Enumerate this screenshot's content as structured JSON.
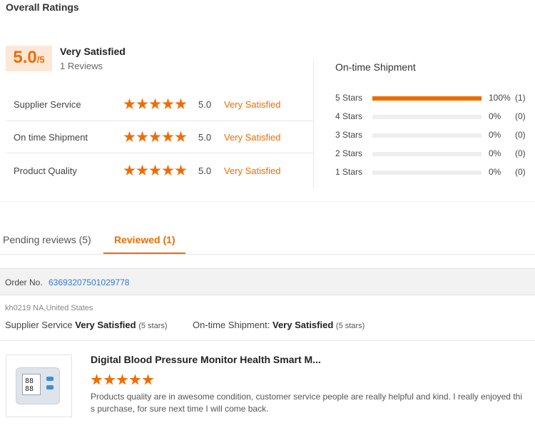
{
  "section_title": "Overall Ratings",
  "overall": {
    "score": "5.0",
    "out_of": "/5",
    "label": "Very Satisfied",
    "reviews": "1 Reviews"
  },
  "ratings": [
    {
      "label": "Supplier Service",
      "score": "5.0",
      "text": "Very Satisfied",
      "stars": 5
    },
    {
      "label": "On time Shipment",
      "score": "5.0",
      "text": "Very Satisfied",
      "stars": 5
    },
    {
      "label": "Product Quality",
      "score": "5.0",
      "text": "Very Satisfied",
      "stars": 5
    }
  ],
  "shipment": {
    "title": "On-time Shipment",
    "rows": [
      {
        "label": "5  Stars",
        "percent": "100%",
        "count": "(1)",
        "fill": 1.0
      },
      {
        "label": "4  Stars",
        "percent": "0%",
        "count": "(0)",
        "fill": 0
      },
      {
        "label": "3  Stars",
        "percent": "0%",
        "count": "(0)",
        "fill": 0
      },
      {
        "label": "2  Stars",
        "percent": "0%",
        "count": "(0)",
        "fill": 0
      },
      {
        "label": "1  Stars",
        "percent": "0%",
        "count": "(0)",
        "fill": 0
      }
    ]
  },
  "tabs": {
    "pending": "Pending reviews (5)",
    "reviewed": "Reviewed (1)"
  },
  "order": {
    "label": "Order No.",
    "number": "63693207501029778"
  },
  "review": {
    "reviewer": "kh0219 NA,United States",
    "supplier_label": "Supplier Service",
    "supplier_value": "Very Satisfied",
    "supplier_stars": "(5 stars)",
    "shipment_label": "On-time Shipment:",
    "shipment_value": "Very Satisfied",
    "shipment_stars": "(5 stars)",
    "product_title": "Digital Blood Pressure Monitor Health Smart M...",
    "product_stars": 5,
    "comment": "Products quality are in awesome condition, customer service people are really helpful and kind.  I really enjoyed this purchase, for sure next time I will come back."
  },
  "colors": {
    "accent": "#f06c00",
    "link": "#2f7bd6"
  }
}
